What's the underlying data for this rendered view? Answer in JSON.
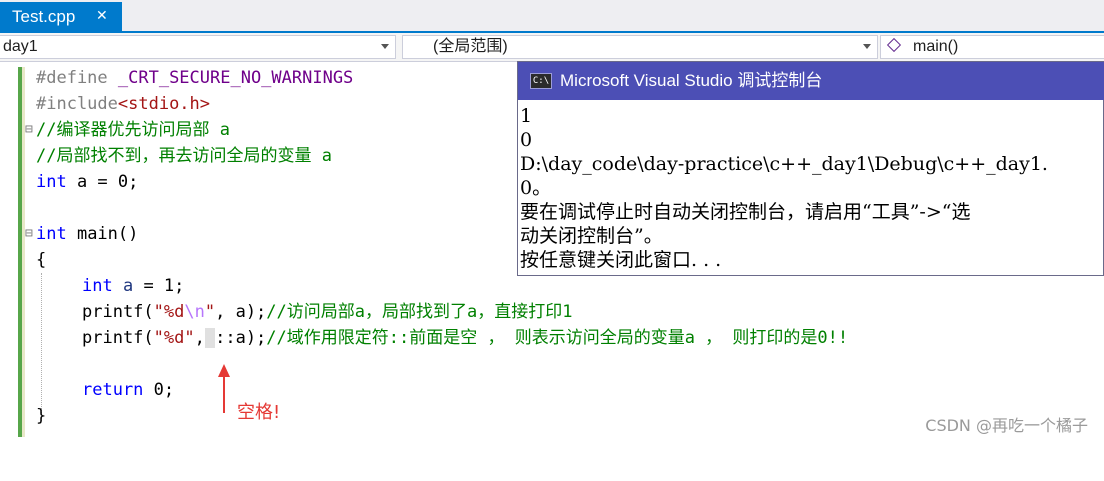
{
  "tab": {
    "label": "Test.cpp",
    "close_glyph": "✕"
  },
  "nav": {
    "project": "day1",
    "scope": "(全局范围)",
    "function": "main()"
  },
  "code": {
    "l1_pp": "#define",
    "l1_macro": " _CRT_SECURE_NO_WARNINGS",
    "l2_pp": "#include",
    "l2_hdr": "<stdio.h>",
    "l3": "//编译器优先访问局部 a",
    "l4": "//局部找不到，再去访问全局的变量 a",
    "l5_kw": "int",
    "l5_rest": " a = 0;",
    "l7_kw": "int",
    "l7_rest": " main()",
    "l8": "{",
    "l9_kw": "int",
    "l9_var": " a",
    "l9_rest": " = 1;",
    "l10_fn": "printf(",
    "l10_str1": "\"%d",
    "l10_esc": "\\n",
    "l10_str2": "\"",
    "l10_mid": ", a);",
    "l10_cmt": "//访问局部a，局部找到了a，直接打印1",
    "l11_fn": "printf(",
    "l11_str": "\"%d\"",
    "l11_comma": ",",
    "l11_space": " ",
    "l11_mid": "::a);",
    "l11_cmt": "//域作用限定符::前面是空 ， 则表示访问全局的变量a ， 则打印的是0!!",
    "l13_kw": "return",
    "l13_rest": " 0;",
    "l14": "}"
  },
  "console": {
    "title": "Microsoft Visual Studio 调试控制台",
    "icon_text": "C:\\",
    "lines": [
      "1",
      "0",
      "D:\\day_code\\day-practice\\c++_day1\\Debug\\c++_day1.",
      "0。",
      "要在调试停止时自动关闭控制台，请启用“工具”->“选",
      "动关闭控制台”。",
      "按任意键关闭此窗口. . ."
    ]
  },
  "annotation": {
    "note": "空格!"
  },
  "watermark": "CSDN @再吃一个橘子",
  "colors": {
    "accent": "#007acc",
    "console_title": "#4c4fb5",
    "annotation": "#e53935"
  }
}
